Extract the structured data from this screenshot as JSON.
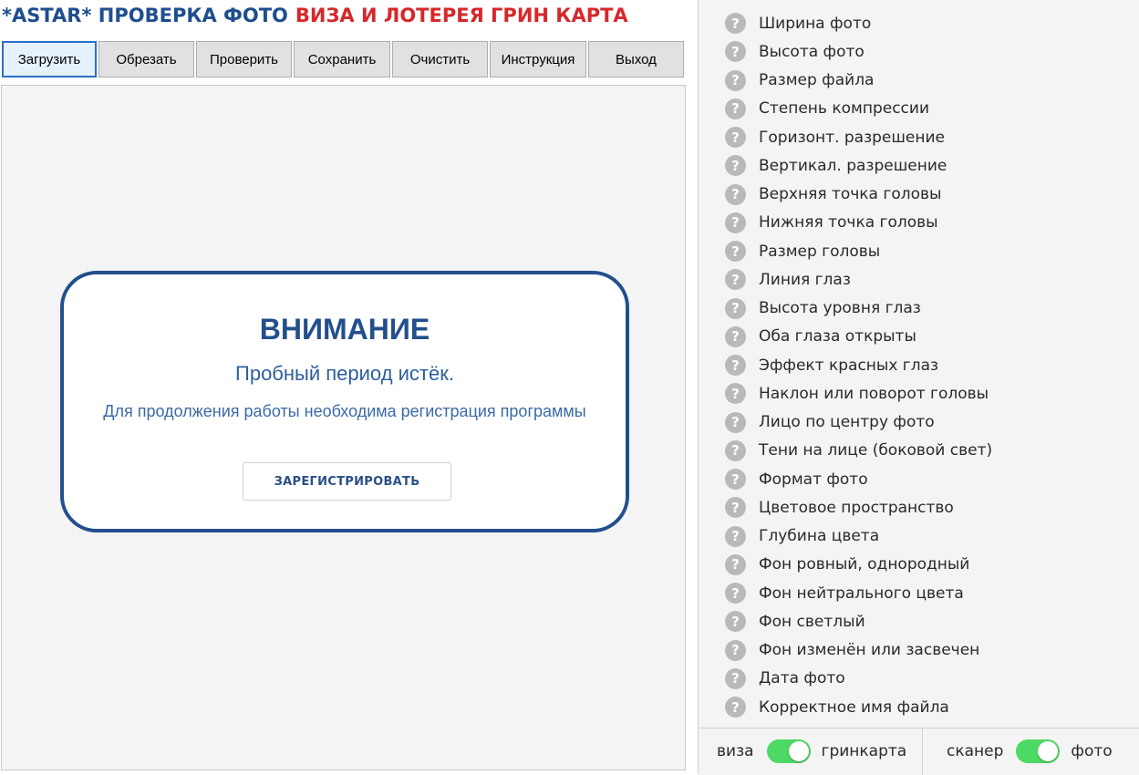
{
  "header": {
    "title_part1": "*ASTAR* ПРОВЕРКА ФОТО",
    "title_part2": "ВИЗА И ЛОТЕРЕЯ ГРИН КАРТА",
    "colors": {
      "primary": "#1e4e8e",
      "accent": "#d6282b"
    }
  },
  "toolbar": {
    "buttons": [
      {
        "label": "Загрузить"
      },
      {
        "label": "Обрезать"
      },
      {
        "label": "Проверить"
      },
      {
        "label": "Сохранить"
      },
      {
        "label": "Очистить"
      },
      {
        "label": "Инструкция"
      },
      {
        "label": "Выход"
      }
    ]
  },
  "notice": {
    "title": "ВНИМАНИЕ",
    "subtitle": "Пробный период истёк.",
    "text": "Для продолжения работы необходима регистрация программы",
    "button_label": "ЗАРЕГИСТРИРОВАТЬ"
  },
  "checklist": {
    "icon": "question-circle-icon",
    "items": [
      "Ширина фото",
      "Высота фото",
      "Размер файла",
      "Степень компрессии",
      "Горизонт. разрешение",
      "Вертикал. разрешение",
      "Верхняя точка головы",
      "Нижняя точка головы",
      "Размер головы",
      "Линия глаз",
      "Высота уровня глаз",
      "Оба глаза открыты",
      "Эффект красных глаз",
      "Наклон или поворот головы",
      "Лицо по центру фото",
      "Тени на лице (боковой свет)",
      "Формат фото",
      "Цветовое пространство",
      "Глубина цвета",
      "Фон ровный, однородный",
      "Фон нейтрального цвета",
      "Фон светлый",
      "Фон изменён или засвечен",
      "Дата фото",
      "Корректное имя файла"
    ]
  },
  "toggles": {
    "mode": {
      "left_label": "виза",
      "right_label": "гринкарта",
      "state": "on"
    },
    "source": {
      "left_label": "сканер",
      "right_label": "фото",
      "state": "on"
    },
    "on_color": "#4cd964"
  }
}
